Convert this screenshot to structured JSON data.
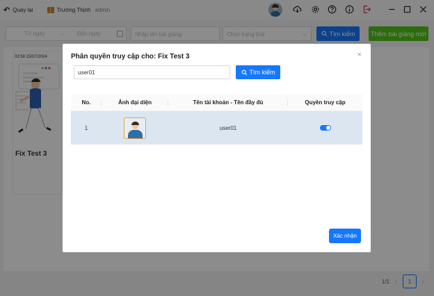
{
  "titlebar": {
    "back_label": "Quay lại",
    "user_name": "Trường Thịnh",
    "user_role": "admin",
    "icons": [
      "avatar",
      "cloud-download-icon",
      "gear-icon",
      "help-icon",
      "info-icon",
      "logout-icon",
      "minimize-icon",
      "maximize-icon",
      "close-icon"
    ]
  },
  "filters": {
    "date_from_placeholder": "Từ ngày",
    "date_arrow": "→",
    "date_to_placeholder": "Đến ngày",
    "name_placeholder": "Nhập tên bài giảng",
    "status_placeholder": "Chọn trạng thái",
    "search_label": "Tìm kiếm",
    "add_label": "Thêm bài giảng mới"
  },
  "cards": [
    {
      "timestamp": "03:58 15/07/2024",
      "title": "Fix Test 3"
    }
  ],
  "pagination": {
    "info": "1/1",
    "prev": "‹",
    "current": "1",
    "next": "›"
  },
  "modal": {
    "title": "Phân quyền truy cập cho: Fix Test 3",
    "close": "×",
    "search_value": "user01",
    "search_label": "Tìm kiếm",
    "columns": [
      "No.",
      "Ảnh đại diện",
      "Tên tài khoản - Tên đầy đủ",
      "Quyền truy cập"
    ],
    "rows": [
      {
        "no": "1",
        "account": "user01",
        "access": true
      }
    ],
    "confirm_label": "Xác nhận"
  },
  "colors": {
    "primary": "#1677ff",
    "success": "#52c41a",
    "row_highlight": "#dbe6f1",
    "danger": "#d9363e"
  }
}
